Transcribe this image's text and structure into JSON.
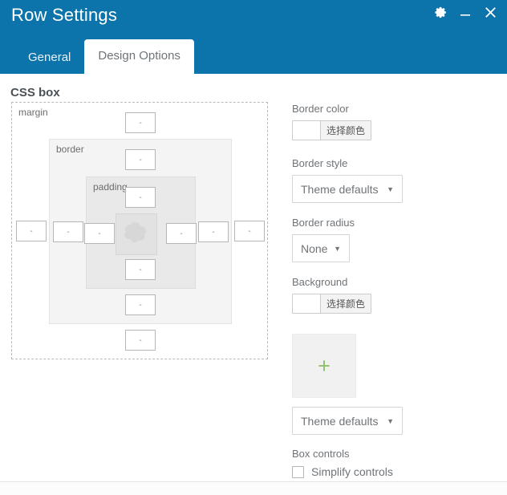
{
  "window": {
    "title": "Row Settings",
    "controls": [
      {
        "name": "settings-gear",
        "icon": "gear-icon"
      },
      {
        "name": "minimize",
        "icon": "minimize-icon"
      },
      {
        "name": "close",
        "icon": "close-icon"
      }
    ]
  },
  "tabs": [
    {
      "label": "General",
      "active": false
    },
    {
      "label": "Design Options",
      "active": true
    }
  ],
  "cssbox": {
    "section_title": "CSS box",
    "labels": {
      "margin": "margin",
      "border": "border",
      "padding": "padding"
    },
    "field_placeholder": "-",
    "fields": {
      "margin_top": "",
      "margin_right": "",
      "margin_bottom": "",
      "margin_left": "",
      "border_top": "",
      "border_right": "",
      "border_bottom": "",
      "border_left": "",
      "padding_top": "",
      "padding_right": "",
      "padding_bottom": "",
      "padding_left": ""
    },
    "content_icon": "image-placeholder-icon"
  },
  "controls": {
    "border_color": {
      "label": "Border color",
      "button_label": "选择颜色",
      "swatch_color": "#ffffff"
    },
    "border_style": {
      "label": "Border style",
      "value": "Theme defaults",
      "options": [
        "Theme defaults"
      ]
    },
    "border_radius": {
      "label": "Border radius",
      "value": "None",
      "options": [
        "None"
      ]
    },
    "background": {
      "label": "Background",
      "button_label": "选择颜色",
      "swatch_color": "#ffffff"
    },
    "background_image": {
      "add_icon": "plus-icon",
      "add_icon_color": "#8ec16a"
    },
    "background_style": {
      "value": "Theme defaults",
      "options": [
        "Theme defaults"
      ]
    },
    "box_controls": {
      "label": "Box controls",
      "checkbox_label": "Simplify controls",
      "checked": false
    }
  },
  "colors": {
    "header_blue": "#0c74ab",
    "accent_green": "#8ec16a",
    "text_gray": "#6f7478"
  }
}
